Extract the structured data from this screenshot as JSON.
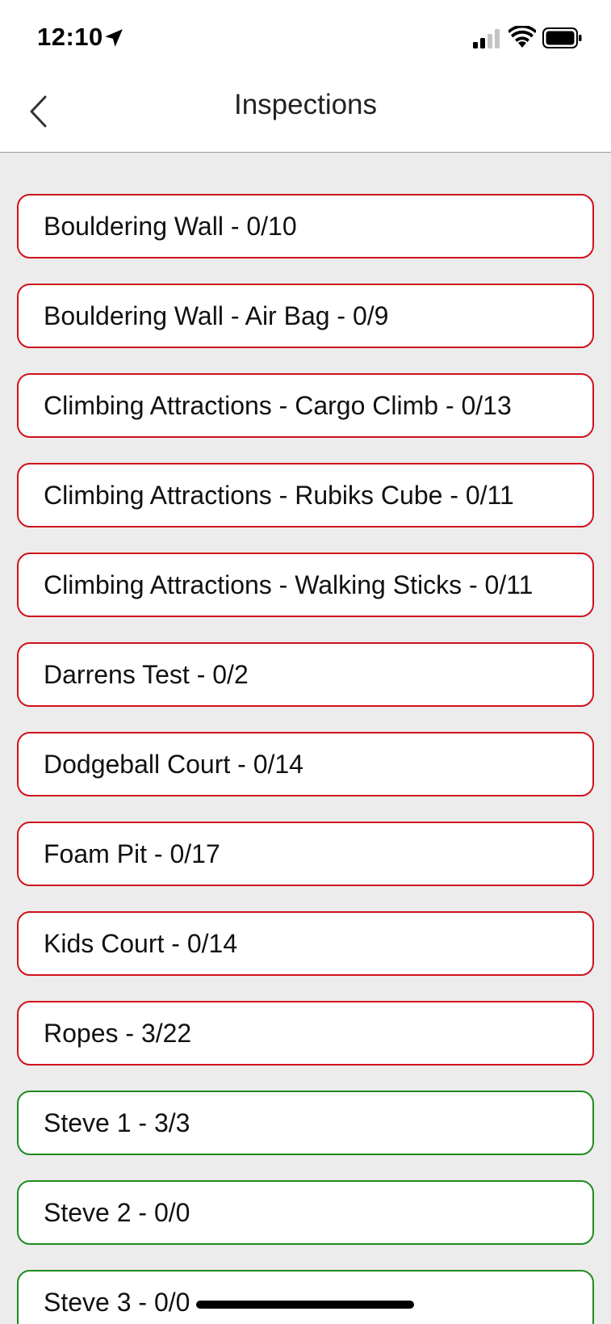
{
  "status_bar": {
    "time": "12:10",
    "icons": [
      "location-arrow-icon",
      "cellular-signal-icon",
      "wifi-icon",
      "battery-icon"
    ]
  },
  "nav": {
    "back_icon": "chevron-left-icon",
    "title": "Inspections"
  },
  "colors": {
    "incomplete_border": "#d0111b",
    "complete_border": "#1f8a1f",
    "list_background": "#ececec"
  },
  "inspections": [
    {
      "label": "Bouldering Wall - 0/10",
      "status": "incomplete"
    },
    {
      "label": "Bouldering Wall - Air Bag - 0/9",
      "status": "incomplete"
    },
    {
      "label": "Climbing Attractions - Cargo Climb - 0/13",
      "status": "incomplete"
    },
    {
      "label": "Climbing Attractions - Rubiks Cube - 0/11",
      "status": "incomplete"
    },
    {
      "label": "Climbing Attractions - Walking Sticks - 0/11",
      "status": "incomplete"
    },
    {
      "label": "Darrens Test - 0/2",
      "status": "incomplete"
    },
    {
      "label": "Dodgeball Court - 0/14",
      "status": "incomplete"
    },
    {
      "label": "Foam Pit - 0/17",
      "status": "incomplete"
    },
    {
      "label": "Kids Court - 0/14",
      "status": "incomplete"
    },
    {
      "label": "Ropes - 3/22",
      "status": "incomplete"
    },
    {
      "label": "Steve 1 - 3/3",
      "status": "complete"
    },
    {
      "label": "Steve 2  - 0/0",
      "status": "complete"
    },
    {
      "label": "Steve 3 - 0/0",
      "status": "complete"
    }
  ]
}
